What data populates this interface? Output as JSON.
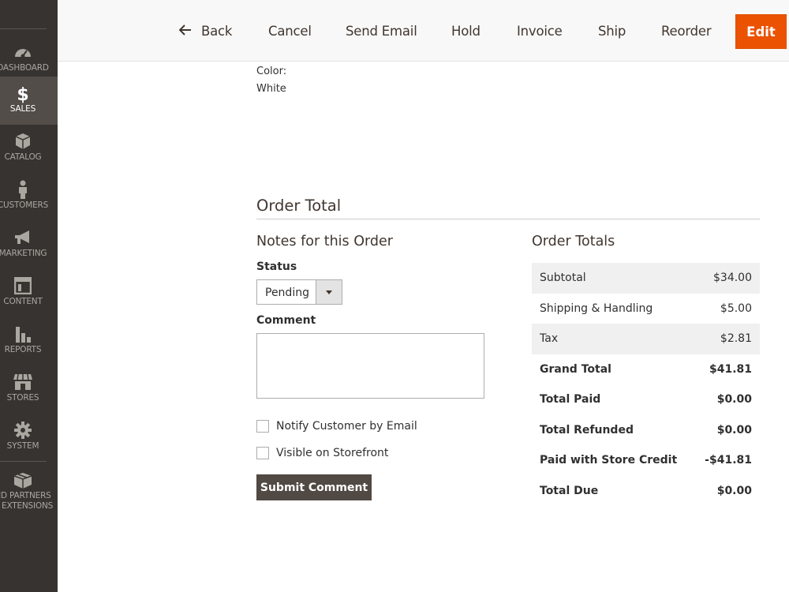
{
  "sidebar": {
    "items": [
      {
        "label": "DASHBOARD",
        "icon": "dashboard-icon"
      },
      {
        "label": "SALES",
        "icon": "dollar-icon",
        "active": true
      },
      {
        "label": "CATALOG",
        "icon": "box-icon"
      },
      {
        "label": "CUSTOMERS",
        "icon": "person-icon"
      },
      {
        "label": "MARKETING",
        "icon": "megaphone-icon"
      },
      {
        "label": "CONTENT",
        "icon": "layout-icon"
      },
      {
        "label": "REPORTS",
        "icon": "bar-chart-icon"
      },
      {
        "label": "STORES",
        "icon": "store-icon"
      },
      {
        "label": "SYSTEM",
        "icon": "gear-icon"
      },
      {
        "label_line1": "ND PARTNERS",
        "label_line2": "& EXTENSIONS",
        "icon": "extensions-box-icon"
      }
    ]
  },
  "header": {
    "back": "Back",
    "cancel": "Cancel",
    "send_email": "Send Email",
    "hold": "Hold",
    "invoice": "Invoice",
    "ship": "Ship",
    "reorder": "Reorder",
    "edit": "Edit"
  },
  "item_option": {
    "label": "Color:",
    "value": "White"
  },
  "order_total": {
    "title": "Order Total",
    "notes": {
      "title": "Notes for this Order",
      "status_label": "Status",
      "status_value": "Pending",
      "comment_label": "Comment",
      "comment_value": "",
      "notify_label": "Notify Customer by Email",
      "visible_label": "Visible on Storefront",
      "submit_label": "Submit Comment"
    },
    "totals": {
      "title": "Order Totals",
      "rows": [
        {
          "label": "Subtotal",
          "value": "$34.00"
        },
        {
          "label": "Shipping & Handling",
          "value": "$5.00"
        },
        {
          "label": "Tax",
          "value": "$2.81"
        },
        {
          "label": "Grand Total",
          "value": "$41.81"
        },
        {
          "label": "Total Paid",
          "value": "$0.00"
        },
        {
          "label": "Total Refunded",
          "value": "$0.00"
        },
        {
          "label": "Paid with Store Credit",
          "value": "-$41.81"
        },
        {
          "label": "Total Due",
          "value": "$0.00"
        }
      ]
    }
  },
  "colors": {
    "sidebar_bg": "#373330",
    "sidebar_active": "#524d49",
    "accent": "#eb5202",
    "submit_bg": "#514943"
  }
}
